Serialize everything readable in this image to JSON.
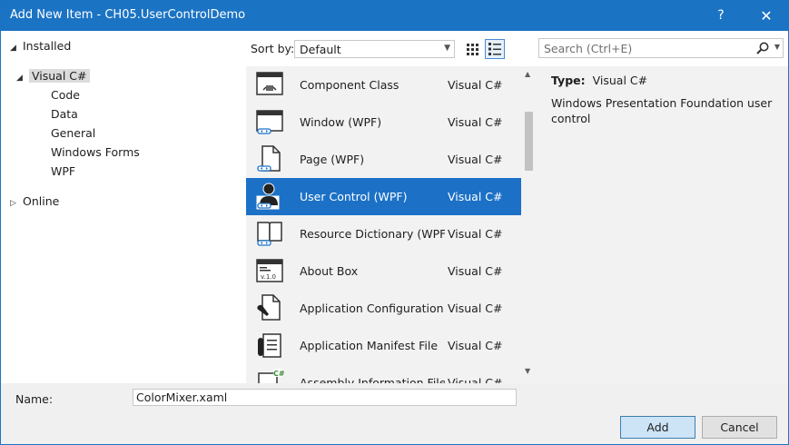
{
  "window": {
    "title": "Add New Item - CH05.UserControlDemo",
    "help": "?",
    "close": "✕"
  },
  "tree": {
    "installed": "Installed",
    "visual_csharp": "Visual C#",
    "children": [
      "Code",
      "Data",
      "General",
      "Windows Forms",
      "WPF"
    ],
    "online": "Online"
  },
  "toolbar": {
    "sort_label": "Sort by:",
    "sort_value": "Default",
    "search_placeholder": "Search (Ctrl+E)"
  },
  "templates": [
    {
      "name": "Component Class",
      "lang": "Visual C#"
    },
    {
      "name": "Window (WPF)",
      "lang": "Visual C#"
    },
    {
      "name": "Page (WPF)",
      "lang": "Visual C#"
    },
    {
      "name": "User Control (WPF)",
      "lang": "Visual C#"
    },
    {
      "name": "Resource Dictionary (WPF)",
      "lang": "Visual C#"
    },
    {
      "name": "About Box",
      "lang": "Visual C#"
    },
    {
      "name": "Application Configuration...",
      "lang": "Visual C#"
    },
    {
      "name": "Application Manifest File",
      "lang": "Visual C#"
    },
    {
      "name": "Assembly Information File",
      "lang": "Visual C#"
    }
  ],
  "details": {
    "type_label": "Type:",
    "type_value": "Visual C#",
    "description": "Windows Presentation Foundation user control"
  },
  "footer": {
    "name_label": "Name:",
    "name_value": "ColorMixer.xaml",
    "add_label": "Add",
    "cancel_label": "Cancel"
  }
}
